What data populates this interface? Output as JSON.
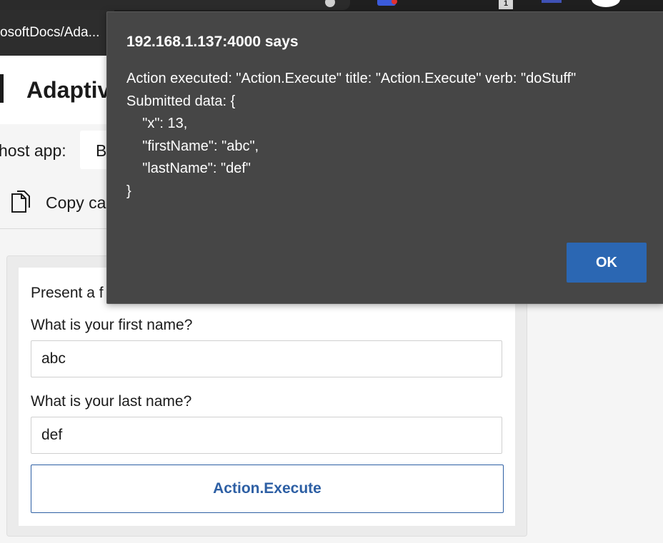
{
  "browser": {
    "tab_title": "osoftDocs/Ada...",
    "extension_badge": "1"
  },
  "page": {
    "title": "Adaptiv",
    "host_app_label": "host app:",
    "host_app_value": "B",
    "copy_button_label": "Copy ca"
  },
  "card": {
    "intro_text": "Present a f",
    "first_name_label": "What is your first name?",
    "first_name_value": "abc",
    "last_name_label": "What is your last name?",
    "last_name_value": "def",
    "action_button_label": "Action.Execute"
  },
  "dialog": {
    "title": "192.168.1.137:4000 says",
    "message": "Action executed: \"Action.Execute\" title: \"Action.Execute\" verb: \"doStuff\"\nSubmitted data: {\n    \"x\": 13,\n    \"firstName\": \"abc\",\n    \"lastName\": \"def\"\n}",
    "ok_label": "OK"
  },
  "colors": {
    "dialog_bg": "#464646",
    "ok_button": "#2b67b3",
    "action_button": "#2d5fa4"
  },
  "icons": [
    "copy-icon"
  ]
}
